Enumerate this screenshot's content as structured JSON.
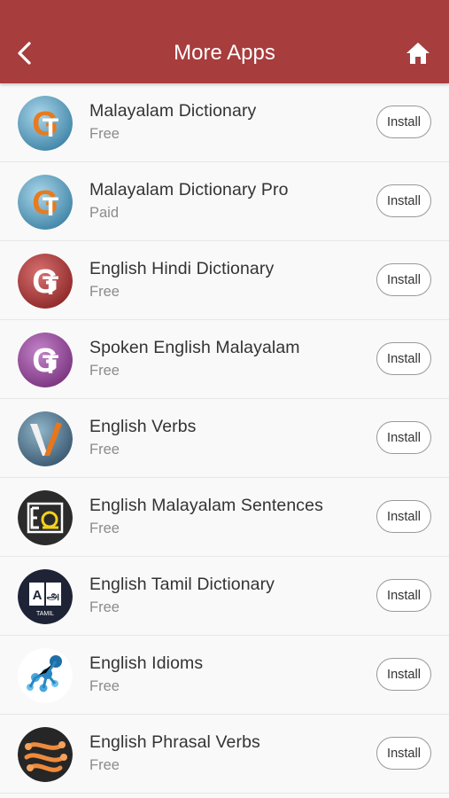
{
  "header": {
    "title": "More Apps",
    "back_icon": "chevron-left-icon",
    "home_icon": "home-icon",
    "color": "#a83d3d"
  },
  "apps": [
    {
      "name": "Malayalam Dictionary",
      "price": "Free",
      "install": "Install",
      "icon": "gt-blue-logo-icon"
    },
    {
      "name": "Malayalam Dictionary Pro",
      "price": "Paid",
      "install": "Install",
      "icon": "gt-blue-logo-icon"
    },
    {
      "name": "English Hindi Dictionary",
      "price": "Free",
      "install": "Install",
      "icon": "gt-red-logo-icon"
    },
    {
      "name": "Spoken English Malayalam",
      "price": "Free",
      "install": "Install",
      "icon": "gt-purple-logo-icon"
    },
    {
      "name": "English Verbs",
      "price": "Free",
      "install": "Install",
      "icon": "verbs-logo-icon"
    },
    {
      "name": "English Malayalam Sentences",
      "price": "Free",
      "install": "Install",
      "icon": "sentences-logo-icon"
    },
    {
      "name": "English Tamil Dictionary",
      "price": "Free",
      "install": "Install",
      "icon": "tamil-dictionary-logo-icon"
    },
    {
      "name": "English Idioms",
      "price": "Free",
      "install": "Install",
      "icon": "idioms-logo-icon"
    },
    {
      "name": "English Phrasal Verbs",
      "price": "Free",
      "install": "Install",
      "icon": "phrasal-verbs-logo-icon"
    }
  ]
}
